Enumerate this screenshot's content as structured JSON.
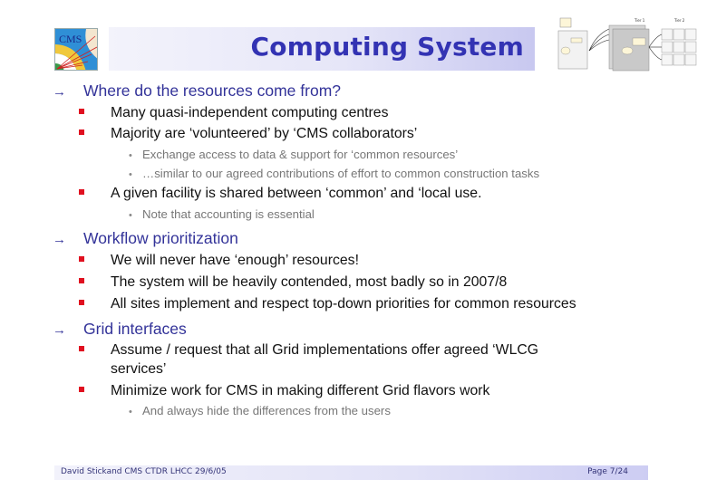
{
  "header": {
    "title": "Computing System",
    "logo_label": "CMS",
    "diagram_icon": "tier-architecture-diagram"
  },
  "sections": [
    {
      "heading": "Where do the resources come from?",
      "bullets": [
        {
          "text": "Many quasi-independent computing centres"
        },
        {
          "text": "Majority are ‘volunteered’ by ‘CMS collaborators’",
          "subbullets": [
            "Exchange access to data & support for ‘common resources’",
            "…similar to our agreed contributions of effort to common construction tasks"
          ]
        },
        {
          "text": "A given facility is shared between ‘common’ and ‘local use.",
          "subbullets": [
            "Note that accounting is essential"
          ]
        }
      ]
    },
    {
      "heading": "Workflow prioritization",
      "bullets": [
        {
          "text": "We will never have ‘enough’ resources!"
        },
        {
          "text": "The system will be heavily contended, most badly so in 2007/8"
        },
        {
          "text": "All sites implement and respect top-down priorities for common resources"
        }
      ]
    },
    {
      "heading": "Grid interfaces",
      "bullets": [
        {
          "text": "Assume / request that all Grid implementations offer agreed ‘WLCG",
          "text_line2": "services’"
        },
        {
          "text": "Minimize work for CMS in making different Grid flavors work",
          "subbullets": [
            "And always hide the differences from the users"
          ]
        }
      ]
    }
  ],
  "footer": {
    "left": "David Stickand CMS CTDR LHCC 29/6/05",
    "right": "Page 7/24"
  },
  "icons": {
    "section_marker": "→",
    "bullet_marker": "square",
    "sub_marker": "•"
  }
}
